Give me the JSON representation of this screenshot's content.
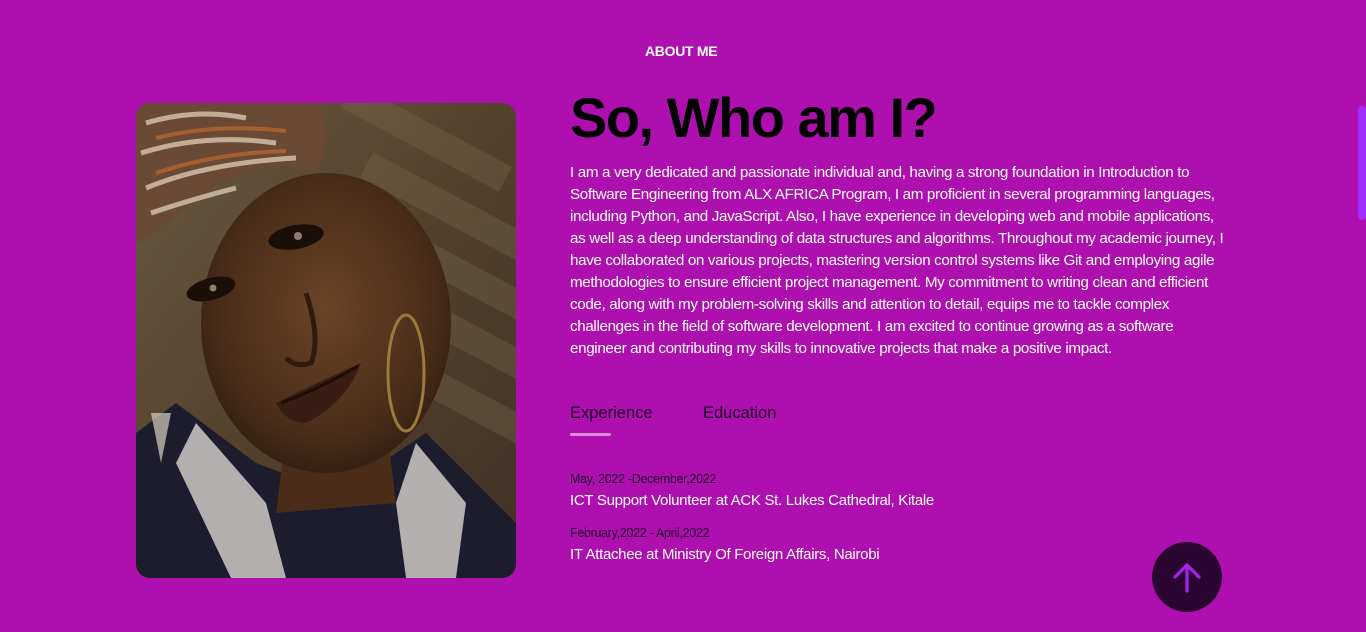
{
  "section": {
    "label": "ABOUT ME"
  },
  "profile": {
    "heading": "So, Who am I?",
    "bio": "I am a very dedicated and passionate individual and, having a strong foundation in Introduction to Software Engineering from ALX AFRICA Program, I am proficient in several programming languages, including Python, and JavaScript. Also, I have experience in developing web and mobile applications, as well as a deep understanding of data structures and algorithms. Throughout my academic journey, I have collaborated on various projects, mastering version control systems like Git and employing agile methodologies to ensure efficient project management. My commitment to writing clean and efficient code, along with my problem-solving skills and attention to detail, equips me to tackle complex challenges in the field of software development. I am excited to continue growing as a software engineer and contributing my skills to innovative projects that make a positive impact."
  },
  "tabs": [
    {
      "label": "Experience",
      "active": true
    },
    {
      "label": "Education",
      "active": false
    }
  ],
  "experience": [
    {
      "date": "May, 2022 -December,2022",
      "title": "ICT Support Volunteer at ACK St. Lukes Cathedral, Kitale"
    },
    {
      "date": "February,2022 - April,2022",
      "title": "IT Attachee at Ministry Of Foreign Affairs, Nairobi"
    }
  ],
  "icons": {
    "back_to_top": "arrow-up-icon"
  },
  "colors": {
    "background": "#ae10af",
    "heading": "#000000",
    "text": "#ffffff",
    "tab_underline": "#d990d8",
    "back_to_top_bg": "#2a0531",
    "back_to_top_arrow": "#a326e8",
    "scrollbar_thumb": "#a22dff"
  }
}
